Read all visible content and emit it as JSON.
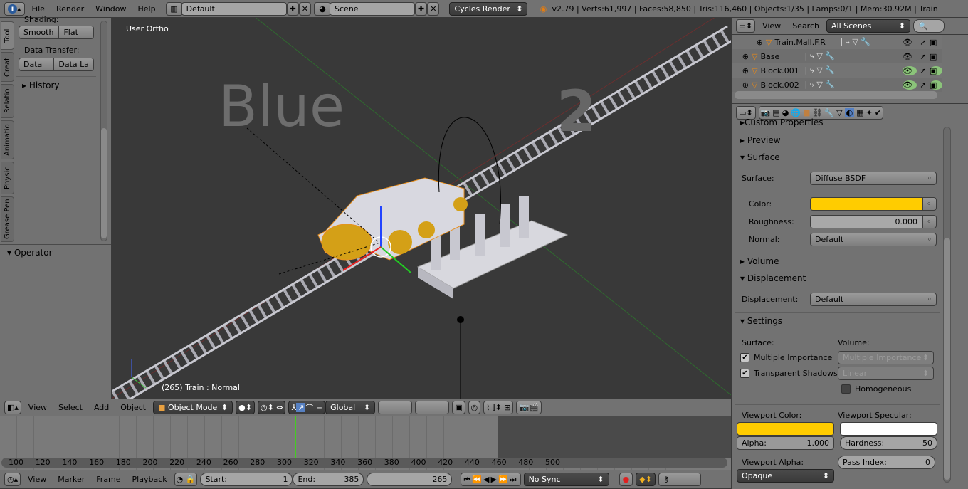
{
  "topbar": {
    "menus": [
      "File",
      "Render",
      "Window",
      "Help"
    ],
    "layout": "Default",
    "scene": "Scene",
    "engine": "Cycles Render",
    "stats": "v2.79 | Verts:61,997 | Faces:58,850 | Tris:116,460 | Objects:1/35 | Lamps:0/1 | Mem:30.92M | Train"
  },
  "toolshelf": {
    "tabs": [
      "Tool",
      "Creat",
      "Relatio",
      "Animatio",
      "Physic",
      "Grease Pen"
    ],
    "shading_label": "Shading:",
    "smooth": "Smooth",
    "flat": "Flat",
    "data_transfer_label": "Data Transfer:",
    "data": "Data",
    "data_layout": "Data La",
    "history": "History",
    "operator": "Operator"
  },
  "viewport": {
    "view_name": "User Ortho",
    "status": "(265) Train : Normal",
    "text_blue": "Blue",
    "text_num": "2"
  },
  "view3d_header": {
    "menus": [
      "View",
      "Select",
      "Add",
      "Object"
    ],
    "mode": "Object Mode",
    "orientation": "Global"
  },
  "timeline": {
    "ticks": [
      "100",
      "120",
      "140",
      "160",
      "180",
      "200",
      "220",
      "240",
      "260",
      "280",
      "300",
      "320",
      "340",
      "360",
      "380",
      "400",
      "420",
      "440",
      "460",
      "480",
      "500"
    ],
    "current_frame_value": 265,
    "menus": [
      "View",
      "Marker",
      "Frame",
      "Playback"
    ],
    "start_label": "Start:",
    "start": "1",
    "end_label": "End:",
    "end": "385",
    "current": "265",
    "sync": "No Sync"
  },
  "outliner": {
    "view": "View",
    "search": "Search",
    "filter": "All Scenes",
    "items": [
      "Train.Mall.F.R",
      "Base",
      "Block.001",
      "Block.002"
    ]
  },
  "properties": {
    "custom_properties": "Custom Properties",
    "preview": "Preview",
    "surface_panel": "Surface",
    "surface_label": "Surface:",
    "surface_value": "Diffuse BSDF",
    "color_label": "Color:",
    "color_value": "#ffcc00",
    "roughness_label": "Roughness:",
    "roughness_value": "0.000",
    "normal_label": "Normal:",
    "normal_value": "Default",
    "volume": "Volume",
    "displacement_panel": "Displacement",
    "displacement_label": "Displacement:",
    "displacement_value": "Default",
    "settings": "Settings",
    "surface_col": "Surface:",
    "volume_col": "Volume:",
    "multiple_importance": "Multiple Importance",
    "transparent_shadows": "Transparent Shadows",
    "vol_multiple_importance": "Multiple Importance",
    "vol_interp": "Linear",
    "homogeneous": "Homogeneous",
    "viewport_color_label": "Viewport Color:",
    "viewport_color": "#ffcc00",
    "viewport_specular_label": "Viewport Specular:",
    "viewport_specular": "#ffffff",
    "alpha_label": "Alpha:",
    "alpha": "1.000",
    "hardness_label": "Hardness:",
    "hardness": "50",
    "viewport_alpha_label": "Viewport Alpha:",
    "viewport_alpha": "Opaque",
    "pass_index_label": "Pass Index:",
    "pass_index": "0"
  }
}
